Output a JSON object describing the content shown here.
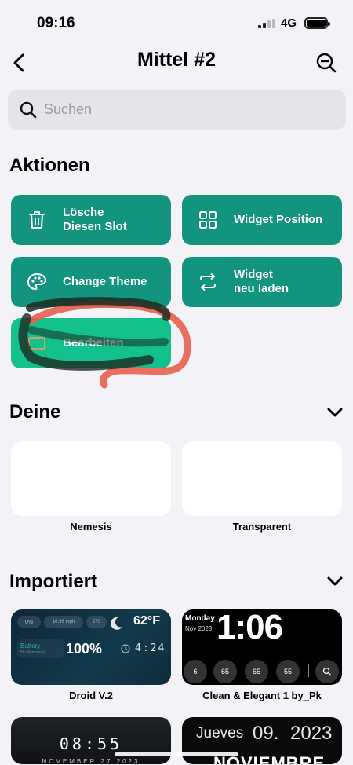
{
  "status_bar": {
    "time": "09:16",
    "network": "4G"
  },
  "nav": {
    "title": "Mittel #2"
  },
  "search": {
    "placeholder": "Suchen"
  },
  "sections": {
    "actions": "Aktionen",
    "yours": "Deine",
    "imported": "Importiert"
  },
  "actions": [
    {
      "line1": "Lösche",
      "line2": "Diesen Slot",
      "icon": "trash-icon"
    },
    {
      "line1": "Widget Position",
      "line2": "",
      "icon": "grid-icon"
    },
    {
      "line1": "Change Theme",
      "line2": "",
      "icon": "palette-icon"
    },
    {
      "line1": "Widget",
      "line2": "neu laden",
      "icon": "refresh-icon"
    },
    {
      "line1": "Bearbeiten",
      "line2": "",
      "icon": "edit-icon"
    }
  ],
  "yours": [
    {
      "label": "Nemesis"
    },
    {
      "label": "Transparent"
    }
  ],
  "imported": [
    {
      "label": "Droid V.2",
      "temp": "62°F",
      "battery_label": "Battery",
      "battery_sub": "5th Remaining",
      "battery_value": "100%",
      "clock": "4:24",
      "chip1": "0%",
      "chip2": "10.96 mph",
      "chip3": "270"
    },
    {
      "label": "Clean & Elegant 1 by_Pk",
      "day": "Monday",
      "date": "Nov 2023",
      "time": "1:06",
      "stats": [
        "6",
        "65",
        "65",
        "55"
      ]
    },
    {
      "label": "",
      "time": "08:55",
      "sub": "NOVEMBER 27 2023"
    },
    {
      "label": "",
      "day": "Jueves",
      "num": "09.",
      "year": "2023",
      "month": "NOVIEMBRE"
    }
  ],
  "colors": {
    "accent": "#13947e",
    "highlight": "#12c18b",
    "annotation": "#e7604f"
  }
}
